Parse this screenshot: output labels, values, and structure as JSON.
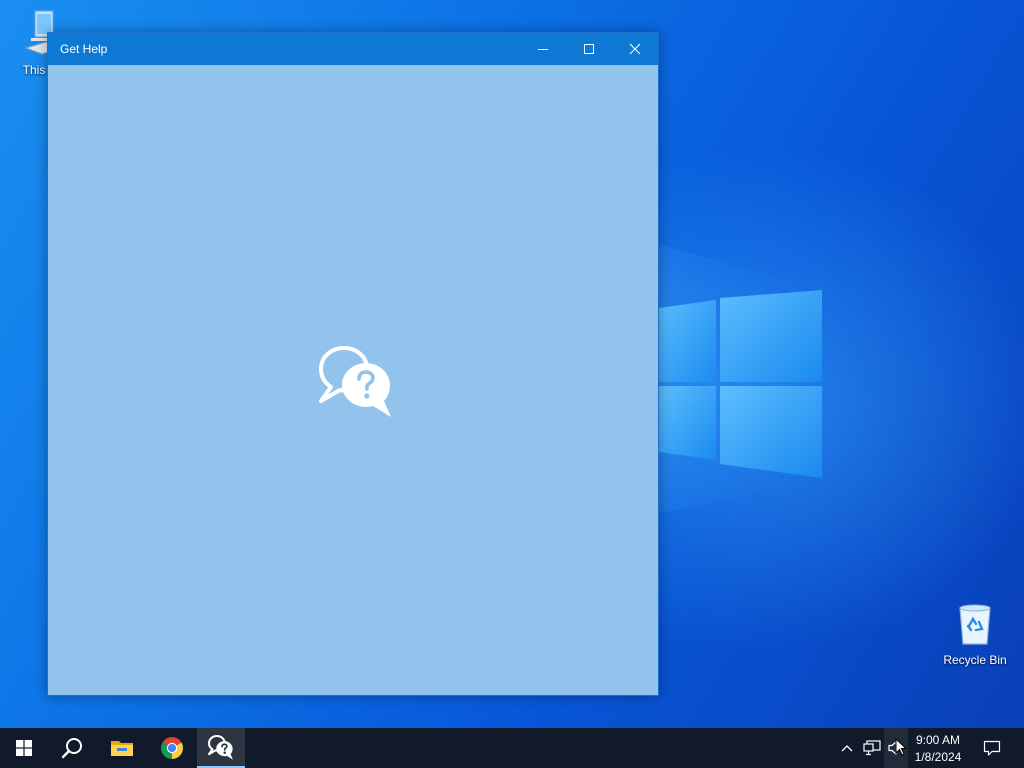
{
  "desktop": {
    "icons": [
      {
        "label": "This PC",
        "icon": "computer-icon"
      },
      {
        "label": "Recycle Bin",
        "icon": "recycle-bin-icon"
      }
    ]
  },
  "window": {
    "title": "Get Help",
    "background_color": "#91c3ec",
    "titlebar_color": "#0e78d5",
    "splash_icon": "get-help-icon",
    "controls": {
      "minimize": "minimize-icon",
      "maximize": "maximize-icon",
      "close": "close-icon"
    }
  },
  "taskbar": {
    "buttons": [
      {
        "name": "Start",
        "icon": "windows-logo-icon"
      },
      {
        "name": "Search",
        "icon": "search-icon"
      },
      {
        "name": "File Explorer",
        "icon": "folder-icon"
      },
      {
        "name": "Google Chrome",
        "icon": "chrome-icon"
      },
      {
        "name": "Get Help",
        "icon": "get-help-icon",
        "active": true
      }
    ],
    "tray": {
      "icons": [
        "chevron-up-icon",
        "network-icon",
        "volume-icon",
        "notification-icon"
      ],
      "time": "9:00 AM",
      "date": "1/8/2024"
    }
  }
}
